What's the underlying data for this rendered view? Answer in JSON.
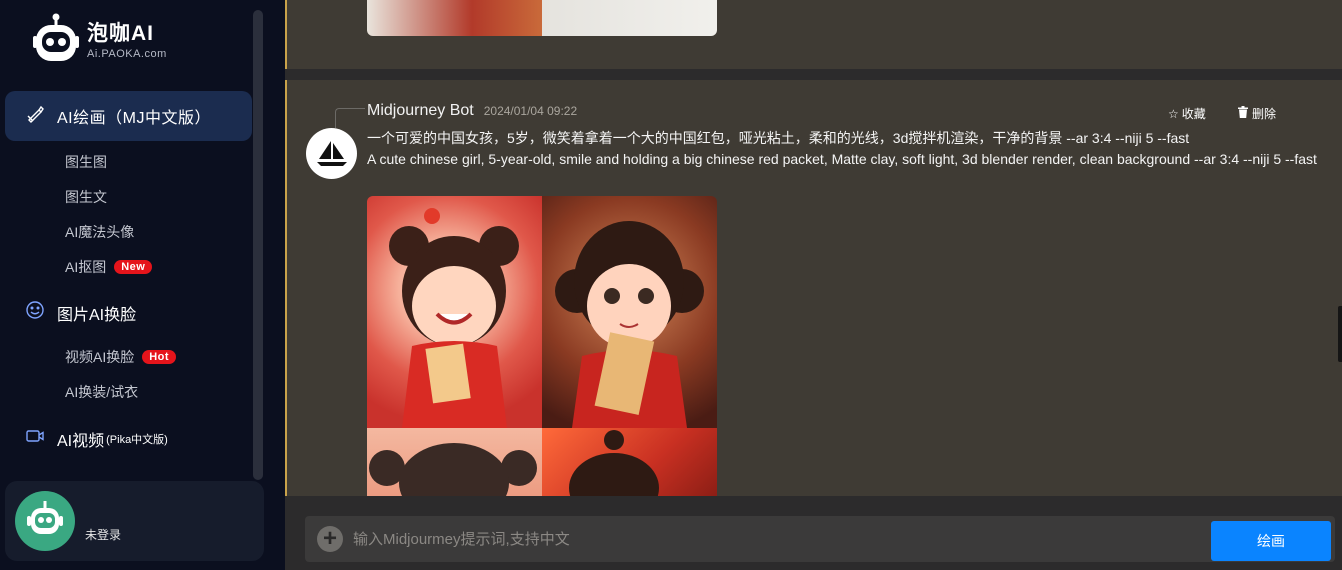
{
  "brand": {
    "name": "泡咖AI",
    "domain": "Ai.PAOKA.com"
  },
  "sidebar": {
    "active_item": {
      "label": "AI绘画（MJ中文版）",
      "icon": "brush-icon"
    },
    "sub_items_1": [
      {
        "label": "图生图"
      },
      {
        "label": "图生文"
      },
      {
        "label": "AI魔法头像"
      },
      {
        "label": "AI抠图",
        "badge": "New"
      }
    ],
    "face_swap": {
      "label": "图片AI换脸",
      "icon": "smile-icon"
    },
    "sub_items_2": [
      {
        "label": "视频AI换脸",
        "badge": "Hot"
      },
      {
        "label": "AI换装/试衣"
      }
    ],
    "video": {
      "label": "AI视频",
      "suffix": "(Pika中文版)",
      "icon": "video-icon"
    }
  },
  "user": {
    "status": "未登录"
  },
  "message": {
    "bot_name": "Midjourney Bot",
    "time": "2024/01/04 09:22",
    "favorite_label": "收藏",
    "delete_label": "删除",
    "prompt_cn": "一个可爱的中国女孩，5岁，微笑着拿着一个大的中国红包，哑光粘土，柔和的光线，3d搅拌机渲染，干净的背景 --ar 3:4 --niji 5 --fast",
    "prompt_en": "A cute chinese girl, 5-year-old, smile and holding a big chinese red packet, Matte clay, soft light, 3d blender render, clean background --ar 3:4 --niji 5 --fast"
  },
  "composer": {
    "placeholder": "输入Midjourmey提示词,支持中文",
    "submit_label": "绘画"
  },
  "colors": {
    "sidebar_bg": "#0b0f1f",
    "active_nav": "#1b2c4f",
    "main_bg": "#3f3b34",
    "accent": "#0a84ff",
    "badge_red": "#e5141b"
  }
}
